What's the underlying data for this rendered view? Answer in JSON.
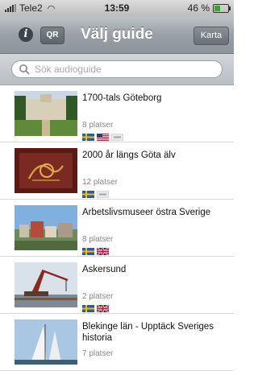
{
  "statusbar": {
    "carrier": "Tele2",
    "time": "13:59",
    "battery_percent": "46 %",
    "battery_level": 0.46
  },
  "navbar": {
    "info_icon_label": "i",
    "qr_label": "QR",
    "title": "Välj guide",
    "map_label": "Karta"
  },
  "search": {
    "placeholder": "Sök audioguide"
  },
  "guides": [
    {
      "title": "1700-tals Göteborg",
      "places": "8 platser",
      "flags": [
        "se",
        "us",
        "other"
      ],
      "image": "park"
    },
    {
      "title": "2000 år längs Göta älv",
      "places": "12 platser",
      "flags": [
        "se",
        "other"
      ],
      "image": "artifact"
    },
    {
      "title": "Arbetslivsmuseer östra Sverige",
      "places": "8 platser",
      "flags": [
        "se",
        "gb"
      ],
      "image": "town"
    },
    {
      "title": "Askersund",
      "places": "2 platser",
      "flags": [
        "se",
        "gb"
      ],
      "image": "crane"
    },
    {
      "title": "Blekinge län - Upptäck Sveriges historia",
      "places": "7 platser",
      "flags": [],
      "image": "sails"
    }
  ],
  "colors": {
    "nav_gradient_top": "#bfc3c7",
    "nav_gradient_bottom": "#8d949a",
    "flag_se_blue": "#2d5aa8",
    "flag_se_yellow": "#f2c200"
  }
}
